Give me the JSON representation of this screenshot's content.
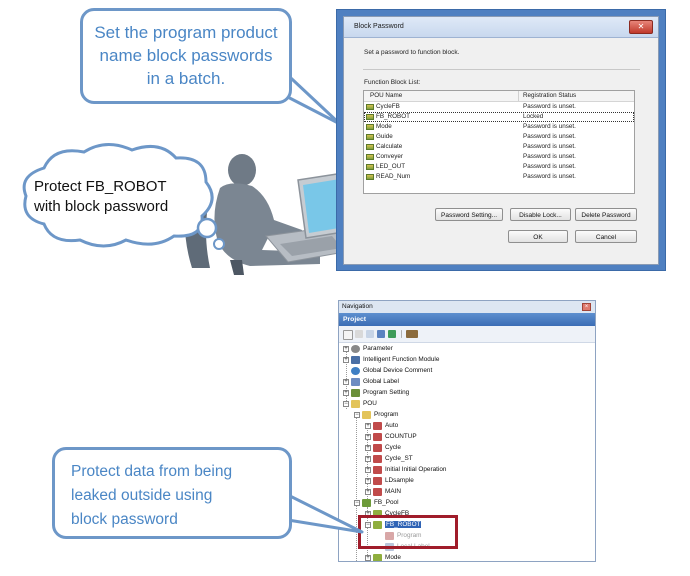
{
  "callouts": {
    "top": {
      "lines": [
        "Set the program product",
        "name block passwords",
        "in a batch."
      ]
    },
    "thought": {
      "lines": [
        "Protect FB_ROBOT",
        "with block password"
      ]
    },
    "bottom": {
      "lines": [
        "Protect data from being",
        "leaked outside using",
        "block password"
      ]
    }
  },
  "dialog": {
    "title": "Block Password",
    "close": "✕",
    "instruction": "Set a password to function block.",
    "list_label": "Function Block List:",
    "columns": [
      "POU Name",
      "Registration Status"
    ],
    "rows": [
      {
        "name": "CycleFB",
        "status": "Password is unset."
      },
      {
        "name": "FB_ROBOT",
        "status": "Locked"
      },
      {
        "name": "Mode",
        "status": "Password is unset."
      },
      {
        "name": "Guide",
        "status": "Password is unset."
      },
      {
        "name": "Calculate",
        "status": "Password is unset."
      },
      {
        "name": "Conveyer",
        "status": "Password is unset."
      },
      {
        "name": "LED_OUT",
        "status": "Password is unset."
      },
      {
        "name": "READ_Num",
        "status": "Password is unset."
      }
    ],
    "buttons": {
      "password_setting": "Password Setting...",
      "disable_lock": "Disable Lock...",
      "delete_password": "Delete Password",
      "ok": "OK",
      "cancel": "Cancel"
    }
  },
  "navigation": {
    "title": "Navigation",
    "close": "×",
    "panel": "Project",
    "tree": {
      "parameter": "Parameter",
      "intelligent_function_module": "Intelligent Function Module",
      "global_device_comment": "Global Device Comment",
      "global_label": "Global Label",
      "program_setting": "Program Setting",
      "pou": "POU",
      "program": "Program",
      "auto": "Auto",
      "countup": "COUNTUP",
      "cycle": "Cycle",
      "cycle_st": "Cycle_ST",
      "initial_operation": "Initial Initial Operation",
      "ldsample": "LDsample",
      "main": "MAIN",
      "fb_pool": "FB_Pool",
      "cyclefb": "CycleFB",
      "fb_robot": "FB_ROBOT",
      "fb_program": "Program",
      "local_label": "Local Label",
      "mode": "Mode"
    }
  },
  "colors": {
    "callout_border": "#6d97c8",
    "callout_text": "#4a86c5",
    "dialog_frame": "#4f80c1",
    "highlight": "#a01c2a"
  }
}
